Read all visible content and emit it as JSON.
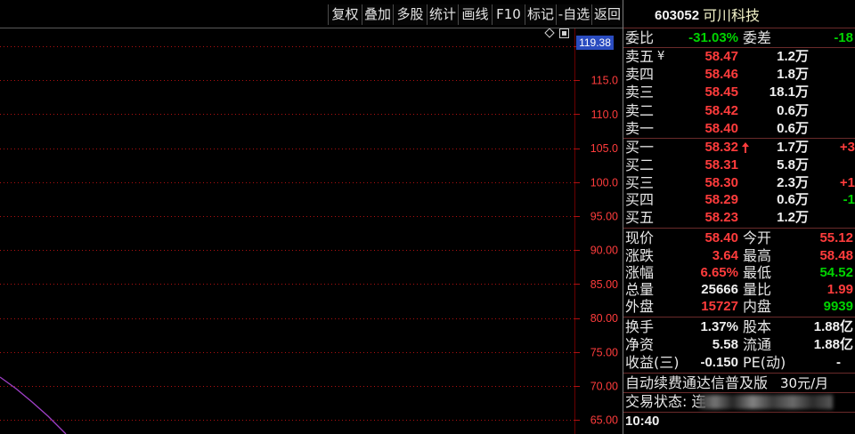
{
  "toolbar": {
    "buttons": [
      "复权",
      "叠加",
      "多股",
      "统计",
      "画线",
      "F10",
      "标记",
      "-自选",
      "返回"
    ]
  },
  "chart": {
    "price_tag": "119.38",
    "gridlines": [
      120,
      115,
      110,
      105,
      100,
      95,
      90,
      85,
      80,
      75,
      70,
      65
    ],
    "axis_labels": [
      "115.0",
      "110.0",
      "105.0",
      "100.0",
      "95.00",
      "90.00",
      "85.00",
      "80.00",
      "75.00",
      "70.00",
      "65.00"
    ],
    "icons": [
      "diamond-icon",
      "window-toggle-icon"
    ]
  },
  "quote": {
    "code": "603052",
    "name": "可川科技",
    "weibi": {
      "label": "委比",
      "value": "-31.03%",
      "label2": "委差",
      "value2": "-18"
    },
    "sell": [
      {
        "label": "卖五",
        "mark": "¥",
        "price": "58.47",
        "volume": "1.2万"
      },
      {
        "label": "卖四",
        "price": "58.46",
        "volume": "1.8万"
      },
      {
        "label": "卖三",
        "price": "58.45",
        "volume": "18.1万"
      },
      {
        "label": "卖二",
        "price": "58.42",
        "volume": "0.6万"
      },
      {
        "label": "卖一",
        "price": "58.40",
        "volume": "0.6万"
      }
    ],
    "buy": [
      {
        "label": "买一",
        "price": "58.32",
        "arrow_icon": "up-arrow-icon",
        "volume": "1.7万",
        "change": "+3"
      },
      {
        "label": "买二",
        "price": "58.31",
        "volume": "5.8万",
        "change": ""
      },
      {
        "label": "买三",
        "price": "58.30",
        "volume": "2.3万",
        "change": "+1"
      },
      {
        "label": "买四",
        "price": "58.29",
        "volume": "0.6万",
        "change": "-1"
      },
      {
        "label": "买五",
        "price": "58.23",
        "volume": "1.2万",
        "change": ""
      }
    ],
    "stats": [
      {
        "label": "现价",
        "value": "58.40",
        "label2": "今开",
        "value2": "55.12"
      },
      {
        "label": "涨跌",
        "value": "3.64",
        "label2": "最高",
        "value2": "58.48"
      },
      {
        "label": "涨幅",
        "value": "6.65%",
        "label2": "最低",
        "value2": "54.52"
      },
      {
        "label": "总量",
        "value": "25666",
        "label2": "量比",
        "value2": "1.99"
      },
      {
        "label": "外盘",
        "value": "15727",
        "label2": "内盘",
        "value2": "9939"
      }
    ],
    "finance": [
      {
        "label": "换手",
        "value": "1.37%",
        "label2": "股本",
        "value2": "1.88亿"
      },
      {
        "label": "净资",
        "value": "5.58",
        "label2": "流通",
        "value2": "1.88亿"
      },
      {
        "label": "收益(三)",
        "value": "-0.150",
        "label2": "PE(动)",
        "value2": "-"
      }
    ],
    "promo": {
      "text": "自动续费通达信普及版",
      "price": "30元/月"
    },
    "trade_status": "交易状态: 连",
    "time": "10:40"
  },
  "colors": {
    "up": "#ff3c3c",
    "down": "#00d400",
    "neutral": "#f0f0f0",
    "grid": "#b01010",
    "axis_label": "#ff3c3c",
    "axis_line": "#6a0000",
    "price_tag_bg": "#2a4cc0",
    "curve": "#a040c8",
    "divider": "#6a2a2a"
  }
}
